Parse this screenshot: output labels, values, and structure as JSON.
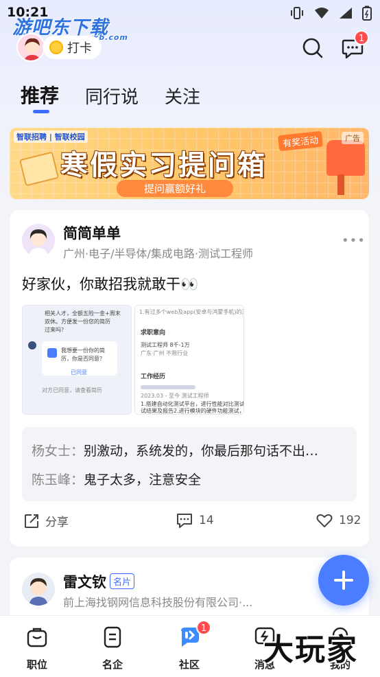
{
  "status_bar": {
    "time": "10:21"
  },
  "watermark": {
    "top": "游吧东下载",
    "top_small": "yxb.com",
    "bottom": "大玩家"
  },
  "header": {
    "checkin_label": "打卡",
    "message_badge": "1"
  },
  "tabs": [
    {
      "label": "推荐",
      "active": true
    },
    {
      "label": "同行说",
      "active": false
    },
    {
      "label": "关注",
      "active": false
    }
  ],
  "banner": {
    "brand": "智联招聘 | 智联校园",
    "title": "寒假实习提问箱",
    "tag": "有奖活动",
    "subtitle": "提问赢额好礼",
    "ad_label": "广告"
  },
  "post": {
    "author": "简简单单",
    "author_title": "广州·电子/半导体/集成电路·测试工程师",
    "text": "好家伙，你敢招我就敢干👀",
    "image1": {
      "line1": "相关人才，全额五险一金+周末",
      "line2": "双休。方便发一份您的简历",
      "line3": "过来吗？",
      "line4": "我想要一份你的简",
      "line5": "历，你是否同意？",
      "line6": "已同意",
      "line7": "对方已同意，请查看简历"
    },
    "image2": {
      "line1": "1.有过多个web及app(安卓与鸿蒙手机)的测试经验",
      "section1": "求职意向",
      "job": "测试工程师  8千-1万",
      "loc": "广东·广州  不限行业",
      "section2": "工作经历",
      "date": "2023.03 - 至今  测试工程师",
      "desc1": "1.搭建自动化测试平台，进行性能对比测试并输出测",
      "desc2": "试结果及报告2.进行模块的硬件功能测试，输出测"
    },
    "comments": [
      {
        "who": "杨女士：",
        "text": "别激动，系统发的，你最后那句话不出…"
      },
      {
        "who": "陈玉峰：",
        "text": "鬼子太多，注意安全"
      }
    ],
    "share_label": "分享",
    "comment_count": "14",
    "like_count": "192"
  },
  "post2": {
    "author": "雷文钦",
    "tag": "名片",
    "author_title": "前上海找钢网信息科技股份有限公司·..."
  },
  "bottom_nav": [
    {
      "label": "职位",
      "icon": "briefcase-icon"
    },
    {
      "label": "名企",
      "icon": "company-icon"
    },
    {
      "label": "社区",
      "icon": "community-icon",
      "badge": "1",
      "active": true
    },
    {
      "label": "消息",
      "icon": "message-icon"
    },
    {
      "label": "我的",
      "icon": "profile-icon"
    }
  ],
  "colors": {
    "accent": "#3c6cff",
    "badge": "#ff4d4f",
    "fab": "#4a7dff"
  }
}
